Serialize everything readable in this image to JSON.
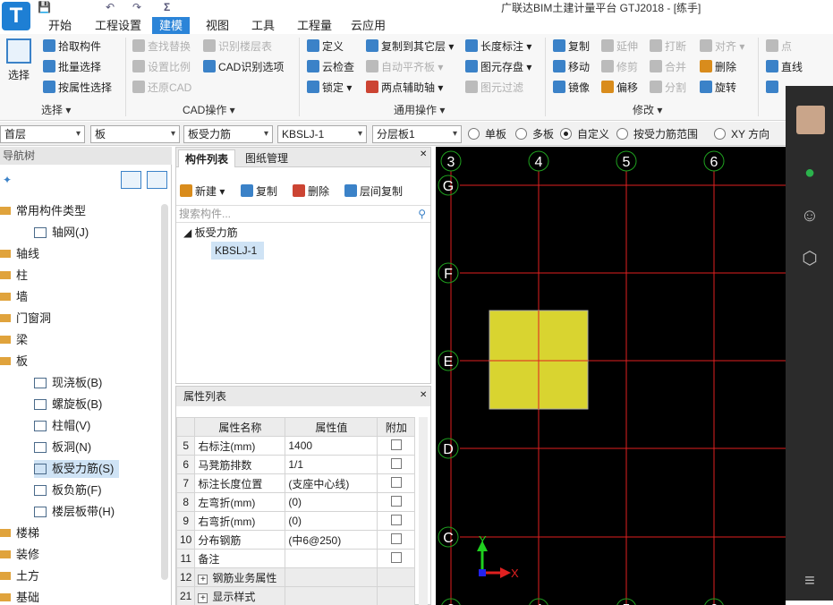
{
  "app": {
    "title": "广联达BIM土建计量平台 GTJ2018 - [练手]",
    "logo": "T"
  },
  "quick_access": [
    "💾",
    "↶",
    "↷",
    "Σ"
  ],
  "tabs": [
    "开始",
    "工程设置",
    "建模",
    "视图",
    "工具",
    "工程量",
    "云应用"
  ],
  "active_tab": "建模",
  "ribbon": {
    "select_label": "选择",
    "pick": "拾取构件",
    "batch": "批量选择",
    "by_attr": "按属性选择",
    "find_replace": "查找替换",
    "set_scale": "设置比例",
    "restore_cad": "还原CAD",
    "id_floor_table": "识别楼层表",
    "cad_options": "CAD识别选项",
    "define": "定义",
    "cloud_check": "云检查",
    "lock": "锁定",
    "copy_floor": "复制到其它层",
    "auto_align": "自动平齐板",
    "two_point_axis": "两点辅助轴",
    "length_mark": "长度标注",
    "elem_save": "图元存盘",
    "elem_filter": "图元过滤",
    "copy": "复制",
    "extend": "延伸",
    "break": "打断",
    "align": "对齐",
    "point": "点",
    "move": "移动",
    "trim": "修剪",
    "merge": "合并",
    "delete": "删除",
    "line": "直线",
    "mirror": "镜像",
    "offset": "偏移",
    "split": "分割",
    "rotate": "旋转",
    "group_select": "选择",
    "group_cad": "CAD操作",
    "group_common": "通用操作",
    "group_modify": "修改"
  },
  "filters": {
    "floor": "首层",
    "category": "板",
    "type": "板受力筋",
    "component": "KBSLJ-1",
    "layer": "分层板1"
  },
  "radios": [
    {
      "label": "单板",
      "checked": false
    },
    {
      "label": "多板",
      "checked": false
    },
    {
      "label": "自定义",
      "checked": true
    },
    {
      "label": "按受力筋范围",
      "checked": false
    },
    {
      "label": "XY 方向",
      "checked": false
    }
  ],
  "nav": {
    "title": "导航树",
    "items": [
      {
        "label": "常用构件类型",
        "level": 0
      },
      {
        "label": "轴网(J)",
        "level": 1
      },
      {
        "label": "轴线",
        "level": 0
      },
      {
        "label": "柱",
        "level": 0
      },
      {
        "label": "墙",
        "level": 0
      },
      {
        "label": "门窗洞",
        "level": 0
      },
      {
        "label": "梁",
        "level": 0
      },
      {
        "label": "板",
        "level": 0
      },
      {
        "label": "现浇板(B)",
        "level": 1
      },
      {
        "label": "螺旋板(B)",
        "level": 1
      },
      {
        "label": "柱帽(V)",
        "level": 1
      },
      {
        "label": "板洞(N)",
        "level": 1
      },
      {
        "label": "板受力筋(S)",
        "level": 1,
        "selected": true
      },
      {
        "label": "板负筋(F)",
        "level": 1
      },
      {
        "label": "楼层板带(H)",
        "level": 1
      },
      {
        "label": "楼梯",
        "level": 0
      },
      {
        "label": "装修",
        "level": 0
      },
      {
        "label": "土方",
        "level": 0
      },
      {
        "label": "基础",
        "level": 0
      }
    ]
  },
  "component_panel": {
    "tab_list": "构件列表",
    "tab_drawings": "图纸管理",
    "new": "新建",
    "copy": "复制",
    "delete": "删除",
    "floor_copy": "层间复制",
    "search_placeholder": "搜索构件...",
    "tree_root": "板受力筋",
    "tree_item": "KBSLJ-1"
  },
  "property_panel": {
    "title": "属性列表",
    "headers": [
      "属性名称",
      "属性值",
      "附加"
    ],
    "rows": [
      {
        "no": "5",
        "name": "右标注(mm)",
        "value": "1400",
        "check": true
      },
      {
        "no": "6",
        "name": "马凳筋排数",
        "value": "1/1",
        "check": true
      },
      {
        "no": "7",
        "name": "标注长度位置",
        "value": "(支座中心线)",
        "check": true
      },
      {
        "no": "8",
        "name": "左弯折(mm)",
        "value": "(0)",
        "check": true
      },
      {
        "no": "9",
        "name": "右弯折(mm)",
        "value": "(0)",
        "check": true
      },
      {
        "no": "10",
        "name": "分布钢筋",
        "value": "(中6@250)",
        "check": true
      },
      {
        "no": "11",
        "name": "备注",
        "value": "",
        "check": true
      },
      {
        "no": "12",
        "name": "钢筋业务属性",
        "value": "",
        "check": false,
        "group": true
      },
      {
        "no": "21",
        "name": "显示样式",
        "value": "",
        "check": false,
        "group": true
      }
    ]
  },
  "canvas": {
    "v_axes": [
      "3",
      "4",
      "5",
      "6"
    ],
    "h_axes": [
      "G",
      "F",
      "E",
      "D",
      "C"
    ],
    "ucs_y": "Y",
    "ucs_x": "X",
    "slab_color": "#d9d430"
  },
  "colors": {
    "accent": "#2b84d8",
    "axis_line": "#e02020",
    "axis_bubble": "#1fa01f"
  }
}
